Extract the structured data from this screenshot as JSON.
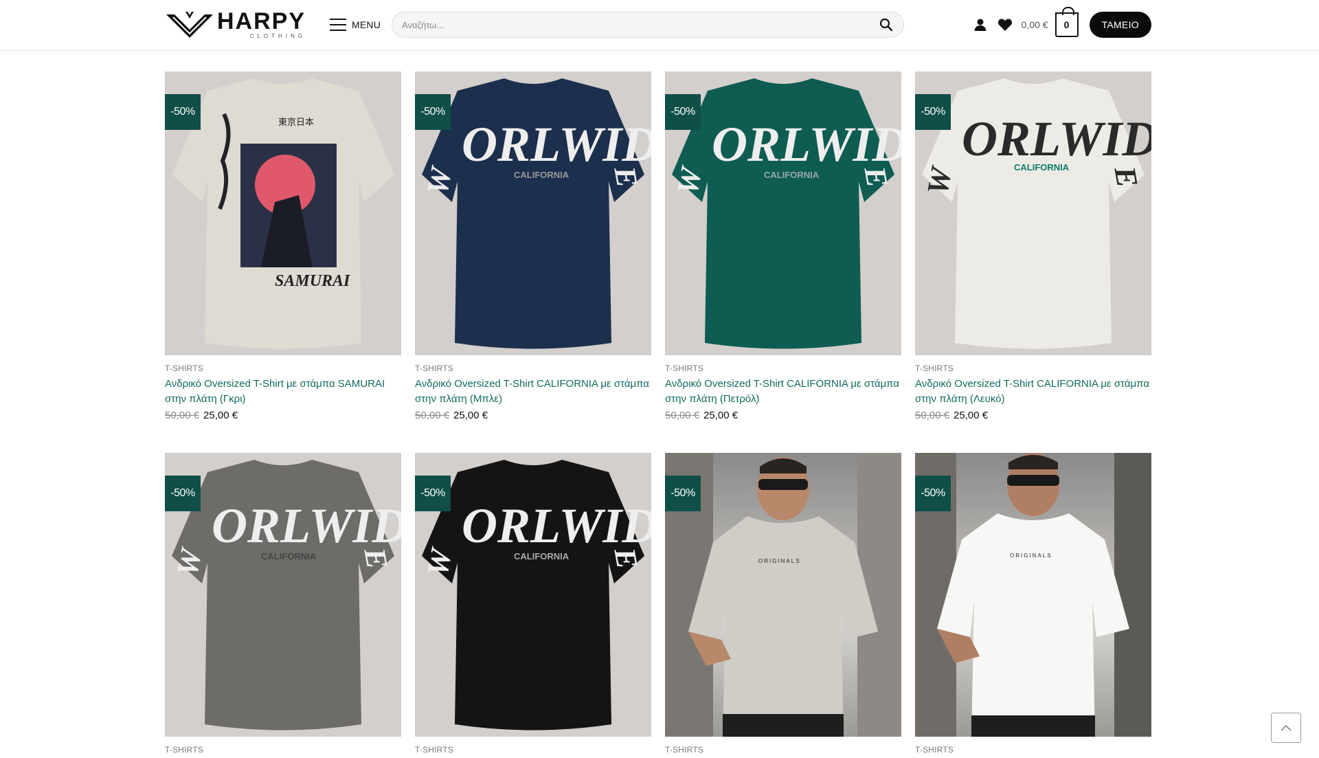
{
  "header": {
    "logo_word": "HARPY",
    "logo_sub": "CLOTHING",
    "menu_label": "MENU",
    "search_placeholder": "Αναζήτω...",
    "cart_total": "0,00 €",
    "cart_count": "0",
    "checkout_label": "ΤΑΜΕΙΟ"
  },
  "colors": {
    "accent": "#0f6b5d",
    "badge": "#0f4f48",
    "checkout": "#0b0b0b"
  },
  "products": [
    {
      "badge": "-50%",
      "category": "T-SHIRTS",
      "title": "Ανδρικό Oversized T-Shirt με στάμπα SAMURAI στην πλάτη (Γκρι)",
      "old_price": "50,00 €",
      "price": "25,00 €",
      "shirt_color": "#dedbd3",
      "print": "SAMURAI"
    },
    {
      "badge": "-50%",
      "category": "T-SHIRTS",
      "title": "Ανδρικό Oversized T-Shirt CALIFORNIA με στάμπα στην πλάτη (Μπλε)",
      "old_price": "50,00 €",
      "price": "25,00 €",
      "shirt_color": "#1c2f4d",
      "print": "ORLWID"
    },
    {
      "badge": "-50%",
      "category": "T-SHIRTS",
      "title": "Ανδρικό Oversized T-Shirt CALIFORNIA με στάμπα στην πλάτη (Πετρόλ)",
      "old_price": "50,00 €",
      "price": "25,00 €",
      "shirt_color": "#0e5c52",
      "print": "ORLWID"
    },
    {
      "badge": "-50%",
      "category": "T-SHIRTS",
      "title": "Ανδρικό Oversized T-Shirt CALIFORNIA με στάμπα στην πλάτη (Λευκό)",
      "old_price": "50,00 €",
      "price": "25,00 €",
      "shirt_color": "#ecebe6",
      "print": "ORLWID"
    },
    {
      "badge": "-50%",
      "category": "T-SHIRTS",
      "shirt_color": "#6e6c69",
      "print": "ORLWID"
    },
    {
      "badge": "-50%",
      "category": "T-SHIRTS",
      "shirt_color": "#141414",
      "print": "ORLWID"
    },
    {
      "badge": "-50%",
      "category": "T-SHIRTS",
      "shirt_color": "#cfcdc6",
      "print": "ORIGINALS"
    },
    {
      "badge": "-50%",
      "category": "T-SHIRTS",
      "shirt_color": "#f7f7f5",
      "print": "ORIGINALS"
    }
  ],
  "print_texts": {
    "samurai_top": "東京日本",
    "samurai_bottom": "SAMURAI",
    "world": "ORLWID",
    "world_w": "W",
    "world_e": "E",
    "california": "CALIFORNIA",
    "originals": "ORIGINALS"
  }
}
